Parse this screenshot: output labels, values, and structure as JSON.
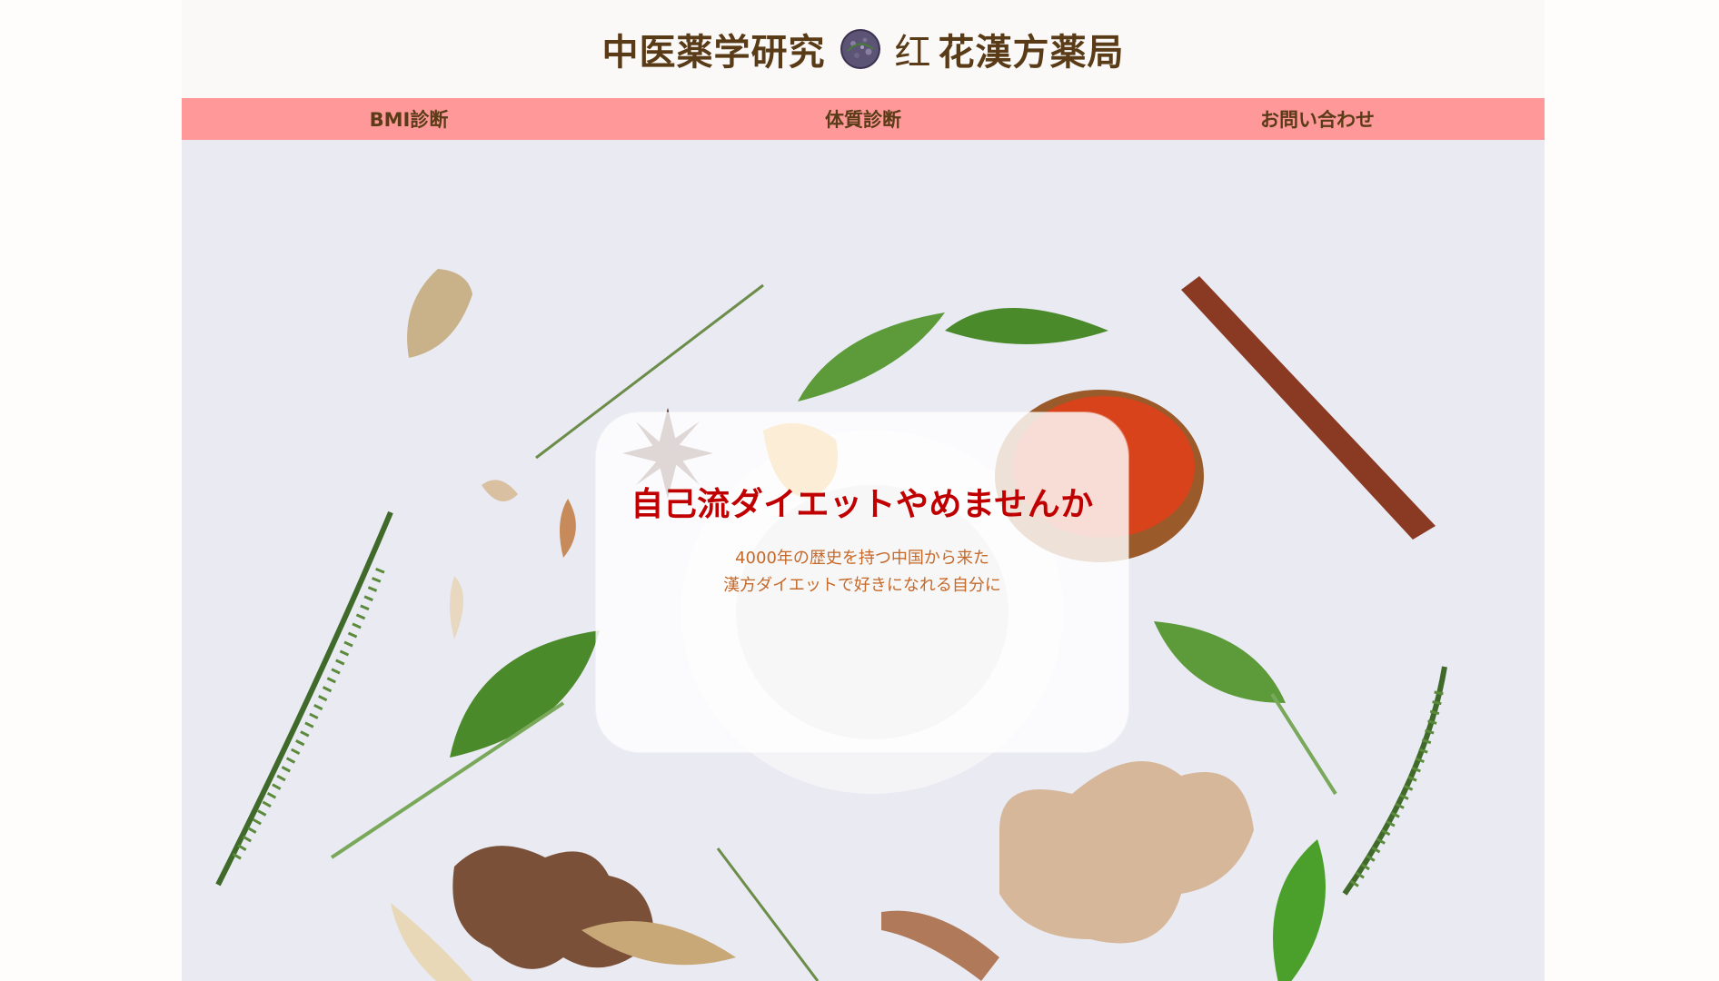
{
  "header": {
    "title_left": "中医薬学研究",
    "title_red_char": "红",
    "title_right": "花漢方薬局"
  },
  "nav": {
    "items": [
      {
        "label": "BMI診断"
      },
      {
        "label": "体質診断"
      },
      {
        "label": "お問い合わせ"
      }
    ]
  },
  "hero": {
    "headline": "自己流ダイエットやめませんか",
    "subline_1": "4000年の歴史を持つ中国から来た",
    "subline_2": "漢方ダイエットで好きになれる自分に"
  },
  "colors": {
    "nav_background": "#ff9898",
    "header_text": "#5a3b17",
    "headline": "#c00000",
    "subline": "#c5692a"
  },
  "icons": {
    "logo": "herb-seal-logo"
  }
}
